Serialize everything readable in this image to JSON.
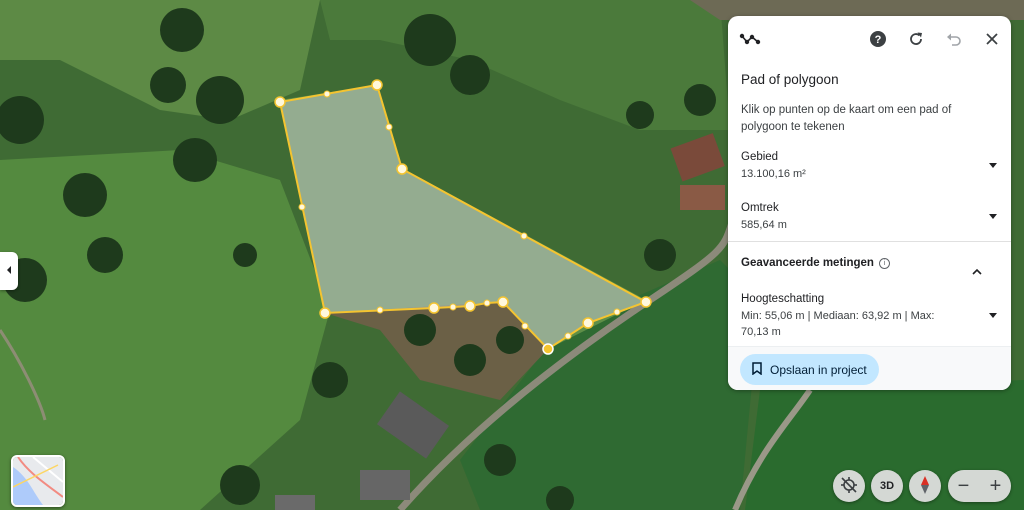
{
  "panel": {
    "title": "Pad of polygoon",
    "description": "Klik op punten op de kaart om een pad of polygoon te tekenen",
    "area": {
      "label": "Gebied",
      "value": "13.100,16 m²"
    },
    "perimeter": {
      "label": "Omtrek",
      "value": "585,64 m"
    },
    "advanced": {
      "label": "Geavanceerde metingen"
    },
    "elevation": {
      "label": "Hoogteschatting",
      "value": "Min: 55,06 m | Mediaan: 63,92 m | Max: 70,13 m"
    },
    "save_label": "Opslaan in project"
  },
  "controls": {
    "btn_3d": "3D"
  },
  "icons": [
    "path-icon",
    "help-icon",
    "refresh-icon",
    "undo-icon",
    "close-icon",
    "info-icon",
    "bookmark-icon",
    "chevron-left-icon",
    "location-off-icon",
    "compass-icon",
    "minus-icon",
    "plus-icon"
  ],
  "colors": {
    "polygon_stroke": "#f4c430",
    "polygon_fill": "#9aa7a8",
    "save_button": "#c2e7ff"
  }
}
